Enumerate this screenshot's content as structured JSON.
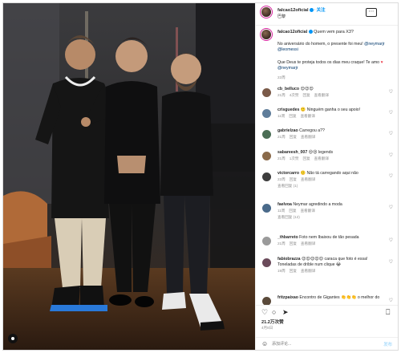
{
  "post": {
    "username": "falcao12oficial",
    "follow_label": "关注",
    "location": "巴黎",
    "more_icon": "ellipsis-icon",
    "caption_time": "22周",
    "caption": {
      "title": "Quem vem para X3?",
      "line2_pre": "No aniversário do homem, o presente foi meu! ",
      "mention1": "@neymarjr",
      "mention2": "@leomessi",
      "line3": "Que Deus te proteja todos os dias meu craque! Te amo ",
      "heart": "♥",
      "mention3": "@neymarjr"
    }
  },
  "comments": [
    {
      "user": "cb_belluco",
      "text": "😍😍😍",
      "time": "21周",
      "likes": "4次赞",
      "reply": "回复",
      "translate": "查看翻译"
    },
    {
      "user": "crisguedes",
      "text": "🙂 Ninguém ganha o seu apoio!",
      "time": "11周",
      "likes": "",
      "reply": "回复",
      "translate": "查看翻译"
    },
    {
      "user": "gabrielzao",
      "text": "Carregou a??",
      "time": "21周",
      "likes": "",
      "reply": "回复",
      "translate": "查看翻译"
    },
    {
      "user": "sabareesh_007",
      "text": "😍😍 legends",
      "time": "21周",
      "likes": "1次赞",
      "reply": "回复",
      "translate": "查看翻译"
    },
    {
      "user": "victorcarro",
      "text": "🙂 Não tá carregando aqui não",
      "time": "22周",
      "likes": "",
      "reply": "回复",
      "translate": "查看翻译",
      "replies": "查看回复 (1)"
    },
    {
      "user": "faelvoa",
      "text": "Neymar agredindo a moda",
      "time": "11周",
      "likes": "",
      "reply": "回复",
      "translate": "查看翻译",
      "replies": "查看回复 (12)"
    },
    {
      "user": "_thbarreto",
      "text": "Foto nem Ibaixou de tão pesada",
      "time": "21周",
      "likes": "",
      "reply": "回复",
      "translate": "查看翻译"
    },
    {
      "user": "fabiobrazza",
      "text": "😍😍😍😍😍 caraca que foto é essa! Toneladas de drible num clique 😂",
      "time": "19周",
      "likes": "",
      "reply": "回复",
      "translate": "查看翻译"
    },
    {
      "user": "fritzpaixao",
      "text": "Encontro de Gigantes 👏👏👏 o melhor do",
      "time": "",
      "likes": "",
      "reply": "",
      "translate": ""
    }
  ],
  "actions": {
    "like_icon": "heart-icon",
    "comment_icon": "comment-icon",
    "share_icon": "send-icon",
    "save_icon": "bookmark-icon"
  },
  "likes_count": "21.2万次赞",
  "post_time": "4月8日",
  "add_comment_placeholder": "添加评论...",
  "post_button": "发布"
}
